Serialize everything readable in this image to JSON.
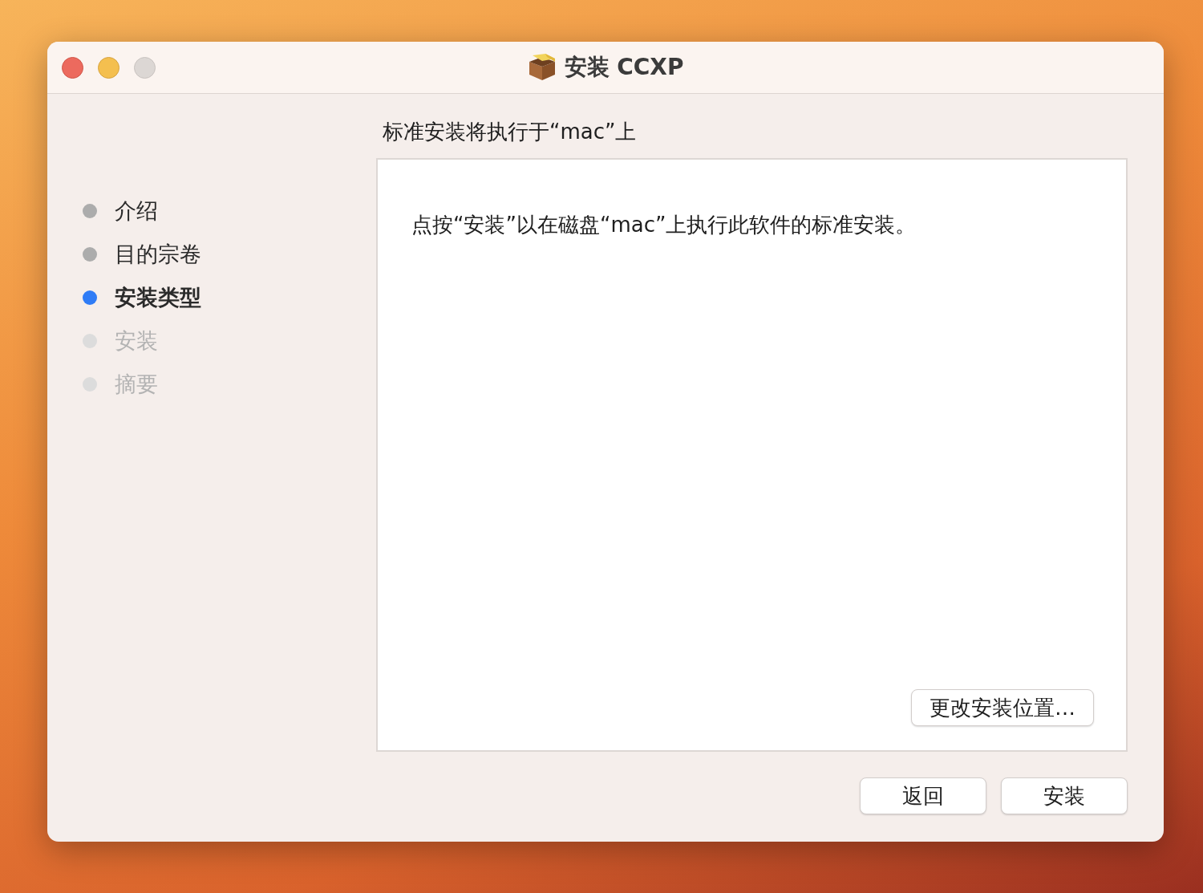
{
  "window": {
    "title": "安装 CCXP"
  },
  "steps": [
    {
      "label": "介绍",
      "selected": false,
      "disabled": false
    },
    {
      "label": "目的宗卷",
      "selected": false,
      "disabled": false
    },
    {
      "label": "安装类型",
      "selected": true,
      "disabled": false
    },
    {
      "label": "安装",
      "selected": false,
      "disabled": true
    },
    {
      "label": "摘要",
      "selected": false,
      "disabled": true
    }
  ],
  "heading": "标准安装将执行于“mac”上",
  "content": {
    "message": "点按“安装”以在磁盘“mac”上执行此软件的标准安装。",
    "change_location_button": "更改安装位置…"
  },
  "buttons": [
    "返回",
    "安装"
  ]
}
